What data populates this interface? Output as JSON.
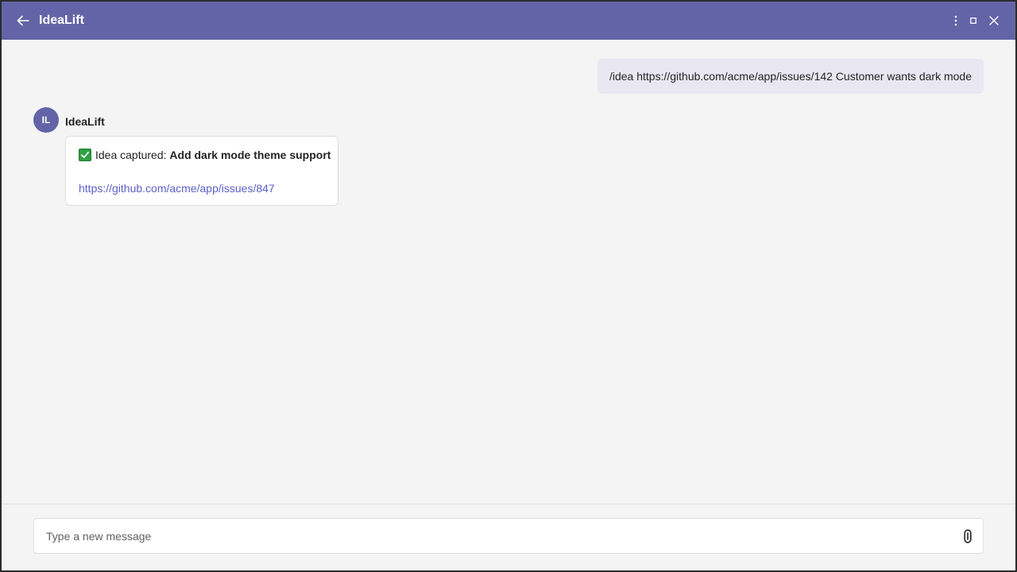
{
  "app": {
    "title": "IdeaLift",
    "brand_color": "#6264a7"
  },
  "titlebar": {
    "back_icon": "arrow-left-icon",
    "more_icon": "more-vertical-icon",
    "maximize_icon": "maximize-icon",
    "close_icon": "close-icon"
  },
  "conversation": {
    "user_message": "/idea https://github.com/acme/app/issues/142 Customer wants dark mode",
    "bot": {
      "avatar_initials": "IL",
      "name": "IdeaLift",
      "card": {
        "status_icon": "check-mark-button-icon",
        "prefix": "Idea captured: ",
        "title": "Add dark mode theme support",
        "link": "https://github.com/acme/app/issues/847"
      }
    }
  },
  "composer": {
    "placeholder": "Type a new message",
    "value": "",
    "attach_icon": "paperclip-icon"
  }
}
